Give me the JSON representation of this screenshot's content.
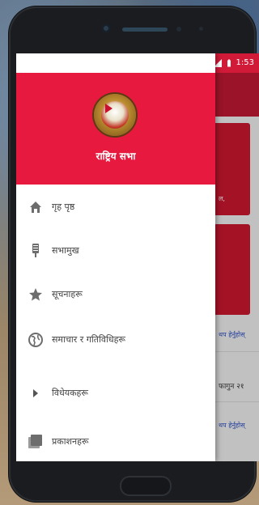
{
  "status_bar": {
    "time": "1:53"
  },
  "drawer": {
    "org_name": "राष्ट्रिय सभा",
    "items": [
      {
        "label": "गृह पृष्ठ",
        "icon": "home-icon"
      },
      {
        "label": "सभामुख",
        "icon": "microphone-icon"
      },
      {
        "label": "सूचनाहरू",
        "icon": "star-icon"
      },
      {
        "label": "समाचार र गतिविधिहरू",
        "icon": "globe-icon"
      },
      {
        "label": "विधेयकहरू",
        "icon": "caret-right-icon"
      },
      {
        "label": "प्रकाशनहरू",
        "icon": "library-icon"
      }
    ]
  },
  "background_app": {
    "card_text": "ल,",
    "links": [
      "थप हेर्नुहोस्",
      "थप हेर्नुहोस्"
    ],
    "date_text": "फागुन २१"
  },
  "colors": {
    "status_bar": "#d01a38",
    "drawer_header": "#e8193e",
    "toolbar": "#bc1831",
    "card": "#c8162f"
  }
}
